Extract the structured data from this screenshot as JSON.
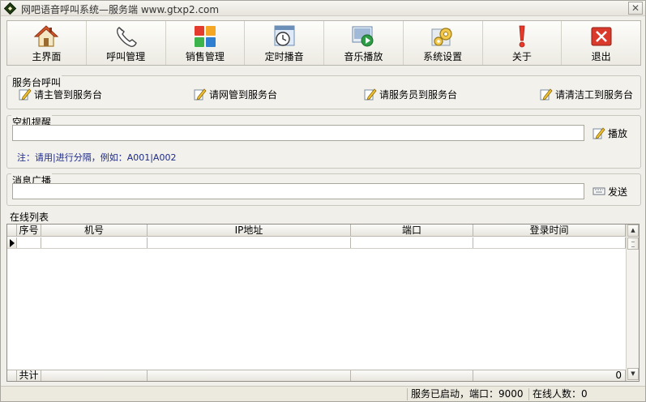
{
  "window": {
    "title": "网吧语音呼叫系统—服务端 www.gtxp2.com",
    "close_label": "✕"
  },
  "toolbar": {
    "items": [
      {
        "label": "主界面",
        "icon": "home-icon"
      },
      {
        "label": "呼叫管理",
        "icon": "phone-icon"
      },
      {
        "label": "销售管理",
        "icon": "color-grid-icon"
      },
      {
        "label": "定时播音",
        "icon": "clock-icon"
      },
      {
        "label": "音乐播放",
        "icon": "media-play-icon"
      },
      {
        "label": "系统设置",
        "icon": "gear-icon"
      },
      {
        "label": "关于",
        "icon": "exclamation-icon"
      },
      {
        "label": "退出",
        "icon": "exit-icon"
      }
    ]
  },
  "service_call": {
    "title": "服务台呼叫",
    "buttons": [
      "请主管到服务台",
      "请网管到服务台",
      "请服务员到服务台",
      "请清洁工到服务台"
    ]
  },
  "idle_reminder": {
    "title": "空机提醒",
    "input_value": "",
    "play_label": "播放",
    "note": "注：请用|进行分隔，例如：A001|A002"
  },
  "broadcast": {
    "title": "消息广播",
    "input_value": "",
    "send_label": "发送"
  },
  "online_list": {
    "title": "在线列表",
    "columns": [
      "序号",
      "机号",
      "IP地址",
      "端口",
      "登录时间"
    ],
    "footer_label": "共计",
    "footer_count": "0"
  },
  "status": {
    "service": "服务已启动，端口：9000",
    "online": "在线人数：0"
  },
  "colors": {
    "background": "#f0efe9",
    "note_text": "#1d2a8a",
    "exit_red": "#d93a2b"
  }
}
